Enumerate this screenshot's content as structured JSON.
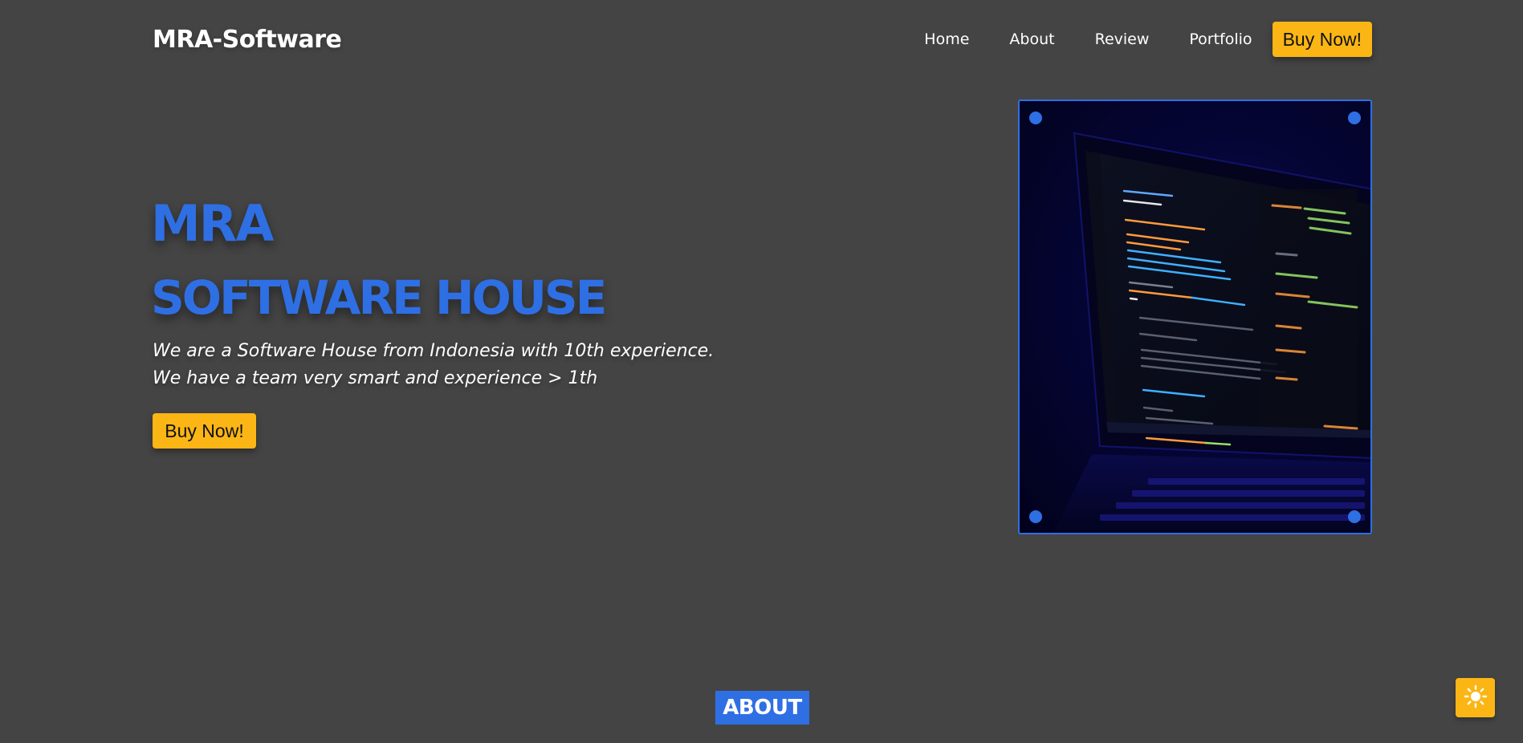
{
  "navbar": {
    "brand": "MRA-Software",
    "links": [
      "Home",
      "About",
      "Review",
      "Portfolio"
    ],
    "buy_label": "Buy Now!"
  },
  "hero": {
    "title_line1": "MRA",
    "title_line2": "SOFTWARE HOUSE",
    "desc_line1": "We are a Software House from Indonesia with 10th experience.",
    "desc_line2": "We have a team very smart and experience > 1th",
    "buy_label": "Buy Now!",
    "image_icon": "laptop-code-photo"
  },
  "about": {
    "heading": "ABOUT"
  },
  "theme_toggle": {
    "icon": "sun-icon"
  },
  "colors": {
    "background": "#444444",
    "accent_blue": "#2f6fe4",
    "button_yellow": "#fbb615",
    "text_white": "#ffffff"
  }
}
